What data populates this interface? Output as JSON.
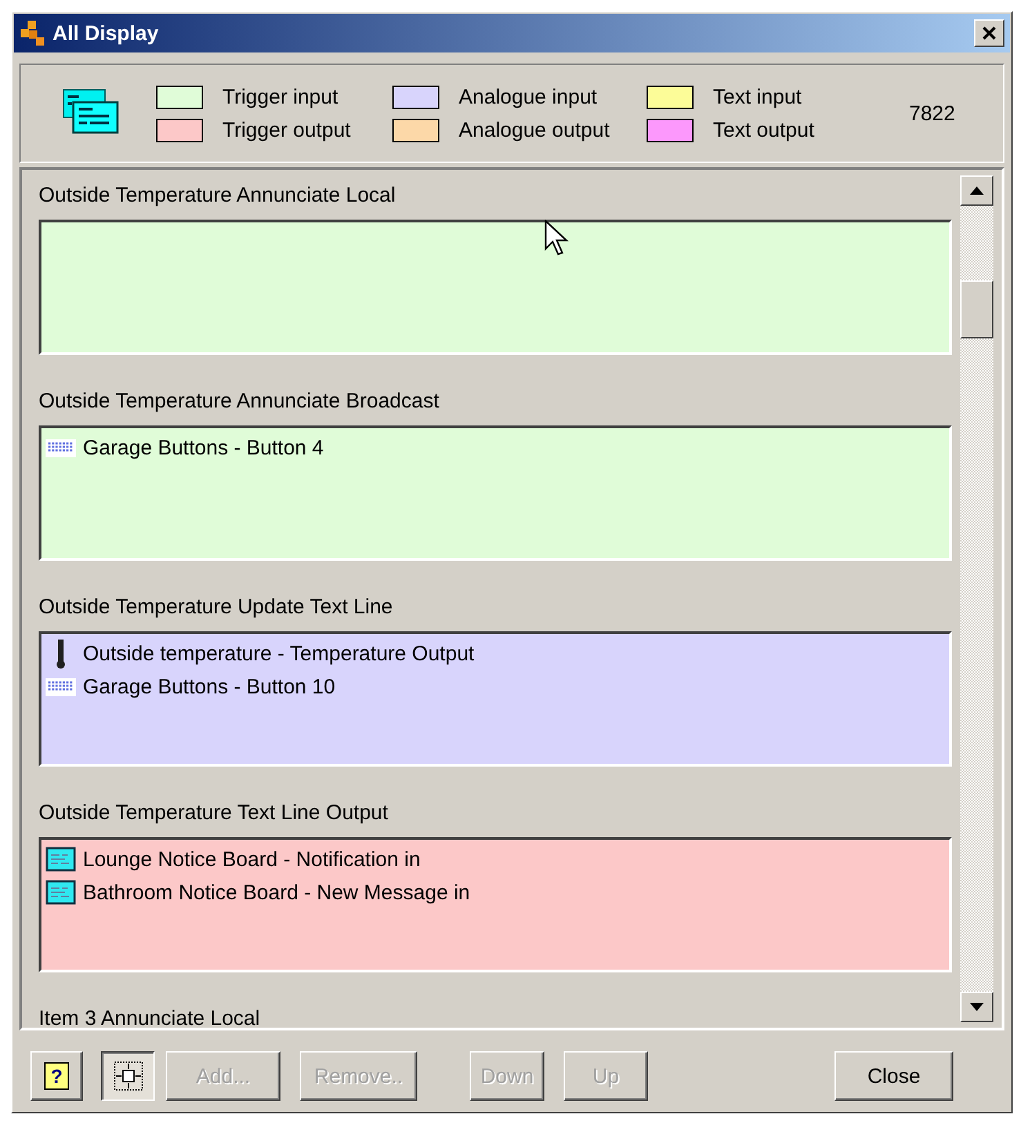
{
  "window": {
    "title": "All Display"
  },
  "legend": [
    {
      "label": "Trigger input",
      "color": "#e0fcd8"
    },
    {
      "label": "Trigger output",
      "color": "#fcc8c8"
    },
    {
      "label": "Analogue input",
      "color": "#d8d4fc"
    },
    {
      "label": "Analogue output",
      "color": "#fcd8a8"
    },
    {
      "label": "Text input",
      "color": "#fcfc98"
    },
    {
      "label": "Text output",
      "color": "#fc98fc"
    }
  ],
  "count": "7822",
  "sections": [
    {
      "title": "Outside Temperature Annunciate Local",
      "color": "#e0fcd8"
    },
    {
      "title": "Outside Temperature Annunciate Broadcast",
      "color": "#e0fcd8",
      "items": [
        {
          "kind": "keypad",
          "label": "Garage Buttons - Button 4"
        }
      ]
    },
    {
      "title": "Outside Temperature Update Text Line",
      "color": "#d8d4fc",
      "items": [
        {
          "kind": "thermometer",
          "label": "Outside temperature - Temperature Output"
        },
        {
          "kind": "keypad",
          "label": "Garage Buttons - Button 10"
        }
      ]
    },
    {
      "title": "Outside Temperature Text Line Output",
      "color": "#fcc8c8",
      "items": [
        {
          "kind": "display",
          "label": "Lounge Notice Board - Notification in"
        },
        {
          "kind": "display",
          "label": "Bathroom Notice Board - New Message in"
        }
      ]
    },
    {
      "title": "Item 3 Annunciate Local"
    }
  ],
  "buttons": [
    {
      "kind": "help",
      "label": "?",
      "disabled": false,
      "pressed": false
    },
    {
      "kind": "fit",
      "disabled": false,
      "pressed": true
    },
    {
      "kind": "text",
      "label": "Add...",
      "disabled": true,
      "pressed": false
    },
    {
      "kind": "text",
      "label": "Remove..",
      "disabled": true,
      "pressed": false
    },
    {
      "kind": "text",
      "label": "Down",
      "disabled": true,
      "pressed": false
    },
    {
      "kind": "text",
      "label": "Up",
      "disabled": true,
      "pressed": false
    },
    {
      "kind": "text",
      "label": "Close",
      "disabled": false,
      "pressed": false
    }
  ]
}
